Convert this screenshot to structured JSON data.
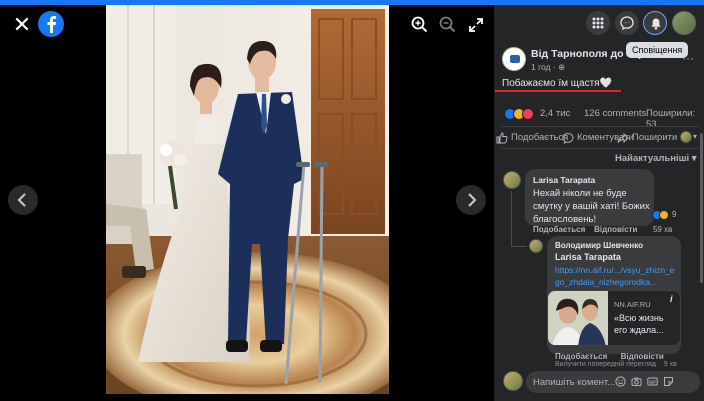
{
  "viewer": {
    "close_icon": "close-icon",
    "logo": "facebook-logo",
    "tools": [
      "zoom-in-icon",
      "zoom-out-icon",
      "fullscreen-icon"
    ],
    "prev_icon": "chevron-left-icon",
    "next_icon": "chevron-right-icon"
  },
  "topbar": {
    "icons": [
      "menu-grid-icon",
      "messenger-icon",
      "bell-icon",
      "profile-avatar"
    ],
    "tooltip": "Сповіщення"
  },
  "post": {
    "page_name": "Від Тарнополя до Тернополя",
    "time": "1 год ·",
    "text": "Побажаємо їм щастя🤍",
    "reactions_count": "2,4 тис",
    "comments_count": "126 comments",
    "shares_count": "Поширили: 53",
    "colors": {
      "accent": "#1877f2",
      "underline": "#e0242a",
      "panel_bg": "#242526"
    }
  },
  "actions": {
    "like": "Подобається",
    "comment": "Коментувати",
    "share": "Поширити"
  },
  "sort": {
    "label": "Найактуальніші ▾"
  },
  "comments": [
    {
      "author": "Larisa Tarapata",
      "text": "Нехай ніколи не буде смутку у вашій хаті! Божих благословень!",
      "reaction_count": "9",
      "like": "Подобається",
      "reply": "Відповісти",
      "time": "59 хв"
    }
  ],
  "reply": {
    "author": "Володимир Шевченко",
    "mention": "Larisa Tarapata",
    "link": "https://nn.aif.ru/.../vsyu_zhizn_ego_zhdala_nizhegorodka...",
    "card_domain": "NN.AIF.RU",
    "card_title": "«Всю жизнь его ждала...",
    "like": "Подобається",
    "reply": "Відповісти",
    "footer": "Вилучити попередній перегляд",
    "time_partial": "9 хв"
  },
  "composer": {
    "placeholder": "Напишіть комент...",
    "icons": [
      "emoji-icon",
      "camera-icon",
      "gif-icon",
      "sticker-icon"
    ]
  }
}
